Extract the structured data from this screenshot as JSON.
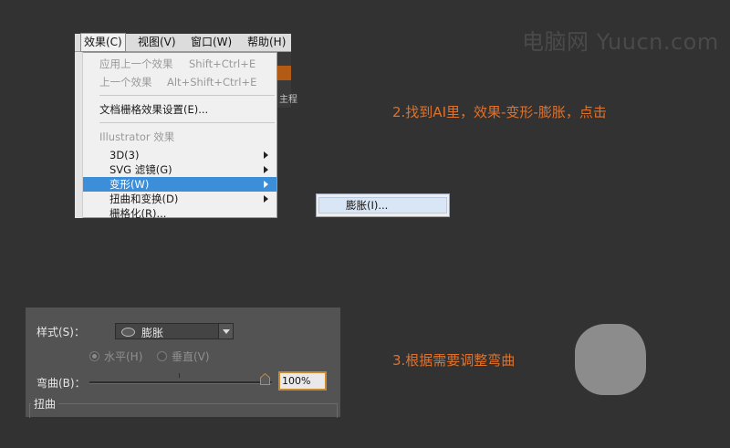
{
  "watermark": "电脑网 Yuucn.com",
  "menubar": {
    "items": [
      "效果(C)",
      "视图(V)",
      "窗口(W)",
      "帮助(H)"
    ]
  },
  "effect_menu": {
    "apply_last": {
      "label": "应用上一个效果",
      "shortcut": "Shift+Ctrl+E"
    },
    "last_effect": {
      "label": "上一个效果",
      "shortcut": "Alt+Shift+Ctrl+E"
    },
    "raster_settings": "文档栅格效果设置(E)...",
    "section_header": "Illustrator 效果",
    "items": [
      "3D(3)",
      "SVG 滤镜(G)",
      "变形(W)",
      "扭曲和变换(D)",
      "栅格化(R)..."
    ],
    "highlighted": "变形(W)"
  },
  "background_text": "主程",
  "submenu": {
    "item": "膨胀(I)..."
  },
  "step2": "2.找到AI里，效果-变形-膨胀，点击",
  "step3": "3.根据需要调整弯曲",
  "dialog": {
    "style_label": "样式(S)：",
    "style_value": "膨胀",
    "horizontal_label": "水平(H)",
    "vertical_label": "垂直(V)",
    "orientation_selected": "水平(H)",
    "bend_label": "弯曲(B)：",
    "bend_value": "100%",
    "bend_fraction": 1.0,
    "distort_label": "扭曲"
  },
  "colors": {
    "background": "#323232",
    "step_text": "#e0712a",
    "menu_highlight": "#3c8ed8",
    "dialog_bg": "#535353",
    "field_focus": "#c98a2d",
    "result_shape": "#8c8c8c"
  },
  "icons": [
    "submenu-arrow-icon",
    "bulge-shape-icon",
    "dropdown-arrow-icon",
    "slider-thumb-icon"
  ]
}
